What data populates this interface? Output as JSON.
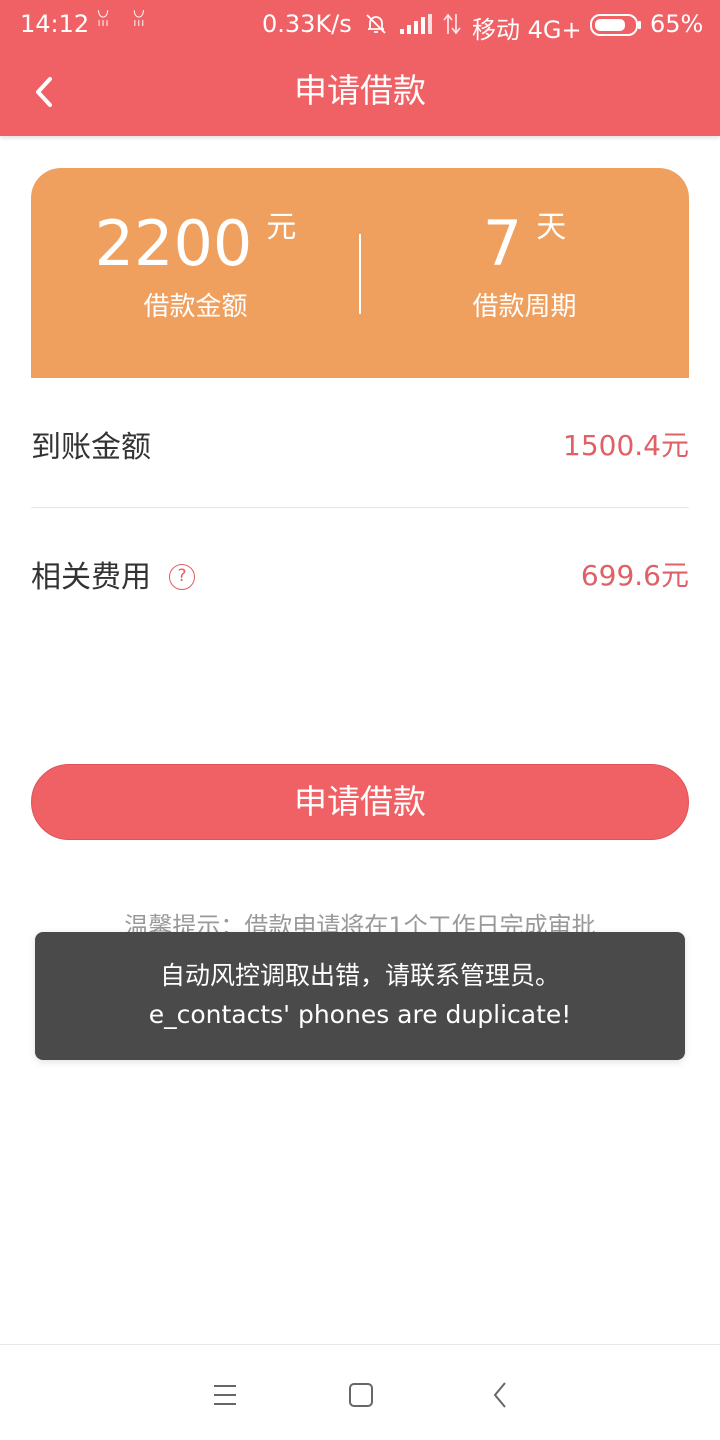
{
  "status_bar": {
    "time": "14:12",
    "glyphs": "ꈍ ꈍ",
    "speed": "0.33K/s",
    "carrier": "移动 4G+",
    "battery_percent": "65%"
  },
  "header": {
    "title": "申请借款"
  },
  "loan_card": {
    "amount_value": "2200",
    "amount_unit": "元",
    "amount_label": "借款金额",
    "period_value": "7",
    "period_unit": "天",
    "period_label": "借款周期"
  },
  "details": {
    "received_label": "到账金额",
    "received_value": "1500.4元",
    "fee_label": "相关费用",
    "fee_help": "?",
    "fee_value": "699.6元"
  },
  "apply_button": {
    "label": "申请借款"
  },
  "tip": {
    "text": "温馨提示：借款申请将在1个工作日完成审批"
  },
  "toast": {
    "line1": "自动风控调取出错，请联系管理员。",
    "line2": "e_contacts' phones are duplicate!"
  },
  "colors": {
    "primary": "#f06165",
    "card": "#f0a05e",
    "value_red": "#e06066",
    "toast_bg": "#4a4a4a"
  }
}
